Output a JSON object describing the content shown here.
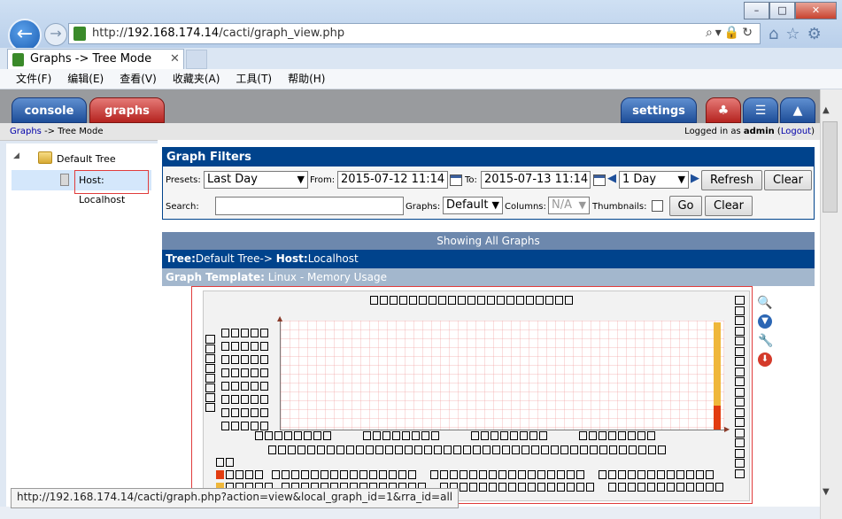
{
  "browser": {
    "url_prefix": "http://",
    "url_host": "192.168.174.14",
    "url_path": "/cacti/graph_view.php",
    "tab_title": "Graphs -> Tree Mode",
    "menu": [
      "文件(F)",
      "编辑(E)",
      "查看(V)",
      "收藏夹(A)",
      "工具(T)",
      "帮助(H)"
    ],
    "status_url": "http://192.168.174.14/cacti/graph.php?action=view&local_graph_id=1&rra_id=all"
  },
  "header": {
    "tabs": {
      "console": "console",
      "graphs": "graphs",
      "settings": "settings"
    },
    "breadcrumb_link": "Graphs",
    "breadcrumb_rest": " -> Tree Mode",
    "logged_in_prefix": "Logged in as ",
    "username": "admin",
    "logout_open": " (",
    "logout_label": "Logout",
    "logout_close": ")"
  },
  "tree": {
    "root": "Default Tree",
    "node": "Host: Localhost"
  },
  "filters": {
    "title": "Graph Filters",
    "presets_label": "Presets:",
    "presets_value": "Last Day",
    "from_label": "From:",
    "from_value": "2015-07-12 11:14",
    "to_label": "To:",
    "to_value": "2015-07-13 11:14",
    "span_value": "1 Day",
    "refresh_label": "Refresh",
    "clear_label": "Clear",
    "search_label": "Search:",
    "search_value": "",
    "graphs_label": "Graphs:",
    "graphs_value": "Default",
    "columns_label": "Columns:",
    "columns_value": "N/A",
    "thumbnails_label": "Thumbnails:",
    "go_label": "Go",
    "clear2_label": "Clear"
  },
  "results": {
    "header": "Showing All Graphs",
    "tree_label": "Tree:",
    "tree_value": "Default Tree->",
    "host_label": "Host:",
    "host_value": "Localhost",
    "template_label": "Graph Template:",
    "template_value": " Linux - Memory Usage"
  },
  "graph": {
    "series_colors": {
      "yellow": "#efb73a",
      "red": "#e23c10"
    }
  }
}
